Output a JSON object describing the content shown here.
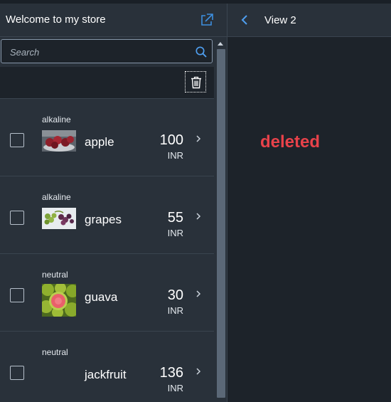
{
  "master": {
    "title": "Welcome to my store",
    "search_placeholder": "Search",
    "icons": {
      "share": "share-icon",
      "search": "search-icon",
      "delete": "delete-icon",
      "chevron": "chevron-right-icon"
    }
  },
  "products": [
    {
      "status": "alkaline",
      "name": "apple",
      "price": "100",
      "currency": "INR",
      "image": "apple"
    },
    {
      "status": "alkaline",
      "name": "grapes",
      "price": "55",
      "currency": "INR",
      "image": "grapes"
    },
    {
      "status": "neutral",
      "name": "guava",
      "price": "30",
      "currency": "INR",
      "image": "guava"
    },
    {
      "status": "neutral",
      "name": "jackfruit",
      "price": "136",
      "currency": "INR",
      "image": ""
    }
  ],
  "detail": {
    "title": "View 2",
    "message": "deleted",
    "message_color": "#e8424a"
  },
  "colors": {
    "accent": "#3d8fe0",
    "panel": "#29313a",
    "background": "#1d232a"
  }
}
